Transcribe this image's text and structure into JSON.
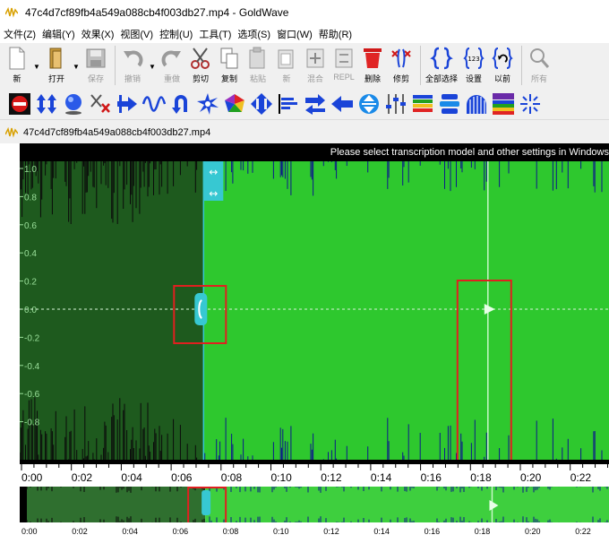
{
  "window": {
    "title": "47c4d7cf89fb4a549a088cb4f003db27.mp4 - GoldWave"
  },
  "menu": [
    "文件(Z)",
    "编辑(Y)",
    "效果(X)",
    "视图(V)",
    "控制(U)",
    "工具(T)",
    "选项(S)",
    "窗口(W)",
    "帮助(R)"
  ],
  "toolbar": {
    "new": "新",
    "open": "打开",
    "save": "保存",
    "undo": "撤销",
    "redo": "重做",
    "cut": "剪切",
    "copy": "复制",
    "paste": "粘贴",
    "new_paste": "新",
    "mix": "混合",
    "repl": "REPL",
    "delete": "删除",
    "trim": "修剪",
    "select_all": "全部选择",
    "set": "设置",
    "previous": "以前",
    "all": "所有"
  },
  "document": {
    "title": "47c4d7cf89fb4a549a088cb4f003db27.mp4"
  },
  "banner": {
    "text": "Please select transcription model and other settings in Windows"
  },
  "amplitude_ticks": [
    "1.0",
    "0.8",
    "0.6",
    "0.4",
    "0.2",
    "0.0",
    "-0.2",
    "-0.4",
    "-0.6",
    "-0.8"
  ],
  "timeline_ticks": [
    "0:00",
    "0:02",
    "0:04",
    "0:06",
    "0:08",
    "0:10",
    "0:12",
    "0:14",
    "0:16",
    "0:18",
    "0:20",
    "0:22"
  ],
  "overview_ticks": [
    "0:00",
    "0:02",
    "0:04",
    "0:06",
    "0:08",
    "0:10",
    "0:12",
    "0:14",
    "0:16",
    "0:18",
    "0:20",
    "0:22"
  ],
  "selection": {
    "start_seconds": 7.3,
    "playhead_seconds": 18.7,
    "visible_end_seconds": 23.3
  },
  "colors": {
    "unselected_wave_bg": "#1e5a1e",
    "selected_wave_bg": "#2ec82e",
    "wave_lines_dark": "#0a0a0a",
    "wave_lines_selected": "#0c1a8a",
    "marker": "#37c8d2",
    "highlight_box": "#e02020"
  }
}
